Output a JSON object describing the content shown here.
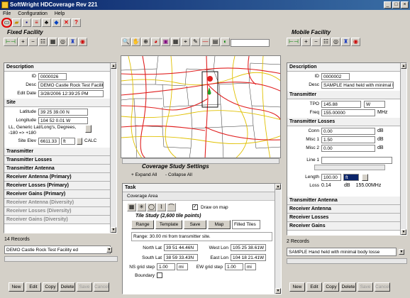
{
  "window": {
    "title": "SoftWright HDCoverage Rev 221"
  },
  "menu": [
    "File",
    "Configuration",
    "Help"
  ],
  "fixed": {
    "title": "Fixed Facility",
    "description_head": "Description",
    "id_label": "ID",
    "id": "0000026",
    "desc_label": "Desc",
    "desc": "DEMO Castle Rock Test Facilit",
    "editdate_label": "Edit Date",
    "editdate": "3/28/2006 12:39:25 PM",
    "site_head": "Site",
    "lat_label": "Latitude",
    "lat": "39 25 39.00 N",
    "lon_label": "Longitude",
    "lon": "104 52 0.01 W",
    "ll_text": "LL, Generic Lat/Long's, Degrees, -180 => +180",
    "elev_label": "Site Elev",
    "elev": "6611.33",
    "elev_unit": "ft",
    "calc": "CALC",
    "sections": [
      "Transmitter",
      "Transmitter Losses",
      "Transmitter Antenna",
      "Receiver Antenna (Primary)",
      "Receiver Losses (Primary)",
      "Receiver Gains (Primary)"
    ],
    "grey_sections": [
      "Receiver Antenna (Diversity)",
      "Receiver Losses (Diversity)",
      "Receiver Gains (Diversity)"
    ],
    "records": "14 Records",
    "selected": "DEMO Castle Rock Test Facility ed"
  },
  "mobile": {
    "title": "Mobile Facility",
    "description_head": "Description",
    "id_label": "ID",
    "id": "0000002",
    "desc_label": "Desc",
    "desc": "SAMPLE Hand held with minimal bo",
    "tx_head": "Transmitter",
    "tpo_label": "TPO",
    "tpo": "145.88",
    "tpo_unit": "W",
    "freq_label": "Freq",
    "freq": "155.00000",
    "freq_unit": "MHz",
    "txloss_head": "Transmitter Losses",
    "conn_label": "Conn",
    "conn": "0.00",
    "misc1_label": "Misc 1",
    "misc1": "1.50",
    "misc2_label": "Misc 2",
    "misc2": "0.00",
    "db": "dB",
    "line1_label": "Line 1",
    "length_label": "Length",
    "length": "100.00",
    "length_unit": "ft",
    "loss_label": "Loss",
    "loss": "0.14",
    "loss_unit": "dB",
    "loss_freq": "155.00MHz",
    "sections": [
      "Transmitter Antenna",
      "Receiver Antenna",
      "Receiver Losses",
      "Receiver Gains"
    ],
    "records": "2 Records",
    "selected": "SAMPLE Hand held with minimal body losse"
  },
  "buttons": {
    "new": "New",
    "edit": "Edit",
    "copy": "Copy",
    "delete": "Delete",
    "save": "Save",
    "cancel": "Cancel"
  },
  "study": {
    "title": "Coverage Study Settings",
    "expand": "+ Expand All",
    "collapse": "- Collapse All",
    "task": "Task",
    "coverage_area": "Coverage Area",
    "draw_on_map": "Draw on map",
    "tile_study": "Tile Study (2,600 tile points)",
    "tabs": [
      "Range",
      "Template",
      "Save",
      "Map"
    ],
    "filled": "Filled Tiles",
    "range_text": "Range: 30.00 mi from transmitter site.",
    "north_label": "North Lat",
    "north": "39 51 44.46N",
    "west_label": "West Lon",
    "west": "105 25 38.61W",
    "south_label": "South Lat",
    "south": "38 59 33.43N",
    "east_label": "East Lon",
    "east": "104 18 21.41W",
    "ns_label": "NS grid step",
    "ns": "1.00",
    "ew_label": "EW grid step",
    "ew": "1.00",
    "unit_mi": "mi",
    "boundary": "Boundary"
  }
}
